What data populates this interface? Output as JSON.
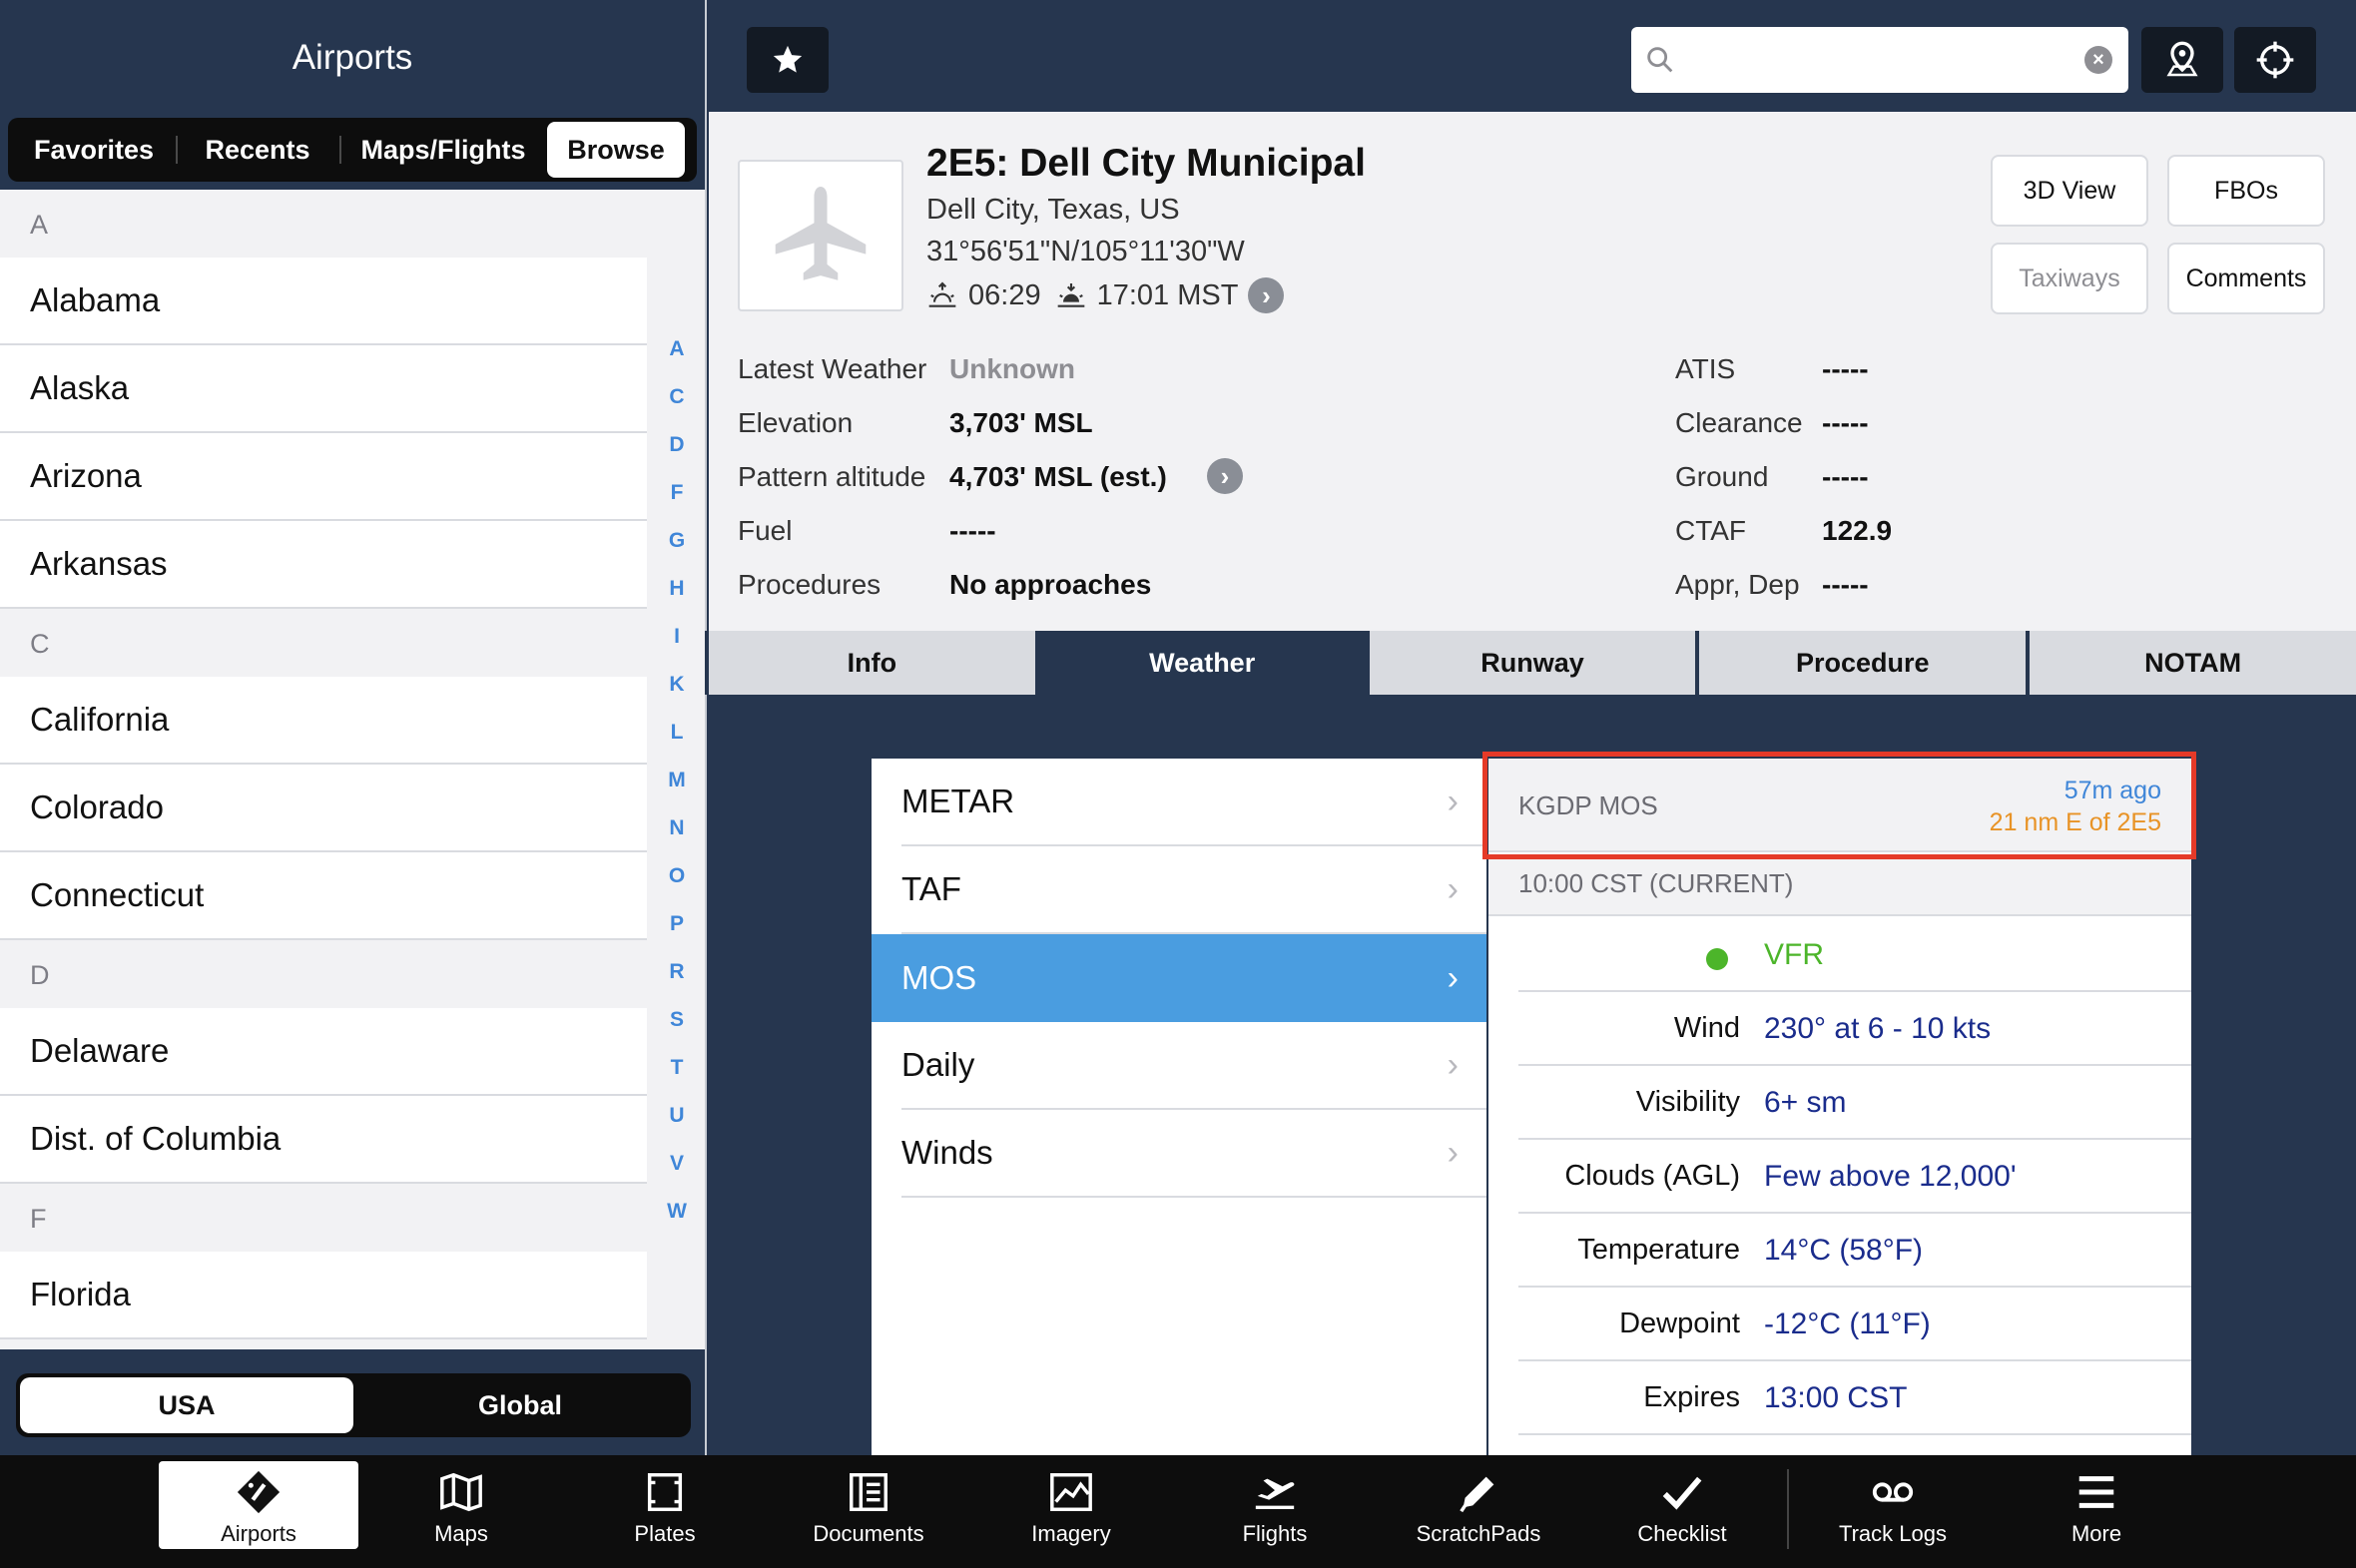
{
  "left": {
    "title": "Airports",
    "tabs": [
      "Favorites",
      "Recents",
      "Maps/Flights",
      "Browse"
    ],
    "active_tab": "Browse",
    "sections": [
      {
        "letter": "A",
        "items": [
          "Alabama",
          "Alaska",
          "Arizona",
          "Arkansas"
        ]
      },
      {
        "letter": "C",
        "items": [
          "California",
          "Colorado",
          "Connecticut"
        ]
      },
      {
        "letter": "D",
        "items": [
          "Delaware",
          "Dist. of Columbia"
        ]
      },
      {
        "letter": "F",
        "items": [
          "Florida"
        ]
      }
    ],
    "index": [
      "A",
      "C",
      "D",
      "F",
      "G",
      "H",
      "I",
      "K",
      "L",
      "M",
      "N",
      "O",
      "P",
      "R",
      "S",
      "T",
      "U",
      "V",
      "W"
    ],
    "region": [
      "USA",
      "Global"
    ],
    "active_region": "USA"
  },
  "topbar": {
    "favorite_icon": "star-icon",
    "search_placeholder": "",
    "search_value": "",
    "map_pin_icon": "map-pin-icon",
    "locate_icon": "crosshair-icon"
  },
  "airport": {
    "title": "2E5: Dell City Municipal",
    "location": "Dell City, Texas, US",
    "coords": "31°56'51\"N/105°11'30\"W",
    "sunrise": "06:29",
    "sunset": "17:01 MST",
    "buttons": {
      "view3d": "3D View",
      "fbos": "FBOs",
      "taxiways": "Taxiways",
      "comments": "Comments"
    },
    "details_left": [
      {
        "label": "Latest Weather",
        "value": "Unknown"
      },
      {
        "label": "Elevation",
        "value": "3,703' MSL"
      },
      {
        "label": "Pattern altitude",
        "value": "4,703' MSL (est.)"
      },
      {
        "label": "Fuel",
        "value": "-----"
      },
      {
        "label": "Procedures",
        "value": "No approaches"
      }
    ],
    "details_right": [
      {
        "label": "ATIS",
        "value": "-----"
      },
      {
        "label": "Clearance",
        "value": "-----"
      },
      {
        "label": "Ground",
        "value": "-----"
      },
      {
        "label": "CTAF",
        "value": "122.9"
      },
      {
        "label": "Appr, Dep",
        "value": "-----"
      }
    ]
  },
  "tabs": [
    "Info",
    "Weather",
    "Runway",
    "Procedure",
    "NOTAM"
  ],
  "active_tab": "Weather",
  "weather": {
    "menu": [
      "METAR",
      "TAF",
      "MOS",
      "Daily",
      "Winds"
    ],
    "selected": "MOS",
    "station": "KGDP MOS",
    "age": "57m ago",
    "distance": "21 nm E of 2E5",
    "period": "10:00 CST (CURRENT)",
    "flight_rules": "VFR",
    "rows": [
      {
        "label": "Wind",
        "value": "230° at 6 - 10 kts"
      },
      {
        "label": "Visibility",
        "value": "6+ sm"
      },
      {
        "label": "Clouds (AGL)",
        "value": "Few above 12,000'"
      },
      {
        "label": "Temperature",
        "value": "14°C (58°F)"
      },
      {
        "label": "Dewpoint",
        "value": "-12°C (11°F)"
      },
      {
        "label": "Expires",
        "value": "13:00 CST"
      }
    ],
    "colors": {
      "vfr": "#4cb52a",
      "value": "#1a2c8c",
      "age": "#3f86d8",
      "distance": "#e89326",
      "highlight": "#e53a28",
      "selected": "#4a9de0"
    }
  },
  "bottom_tabs": [
    {
      "label": "Airports",
      "icon": "airports-icon"
    },
    {
      "label": "Maps",
      "icon": "maps-icon"
    },
    {
      "label": "Plates",
      "icon": "plates-icon"
    },
    {
      "label": "Documents",
      "icon": "documents-icon"
    },
    {
      "label": "Imagery",
      "icon": "imagery-icon"
    },
    {
      "label": "Flights",
      "icon": "flights-icon"
    },
    {
      "label": "ScratchPads",
      "icon": "scratchpads-icon"
    },
    {
      "label": "Checklist",
      "icon": "checklist-icon"
    },
    {
      "label": "Track Logs",
      "icon": "track-logs-icon"
    },
    {
      "label": "More",
      "icon": "more-icon"
    }
  ],
  "active_bottom_tab": "Airports"
}
